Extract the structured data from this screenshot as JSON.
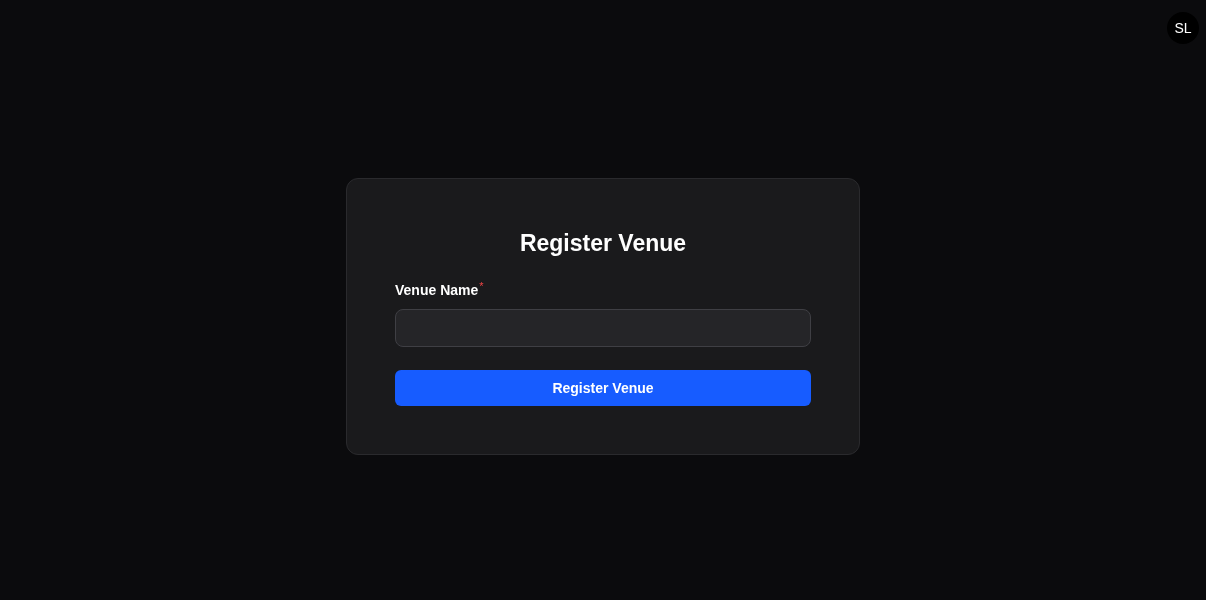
{
  "avatar": {
    "initials": "SL"
  },
  "form": {
    "title": "Register Venue",
    "fields": [
      {
        "label": "Venue Name",
        "required_mark": "*"
      }
    ],
    "submit": "Register Venue"
  }
}
